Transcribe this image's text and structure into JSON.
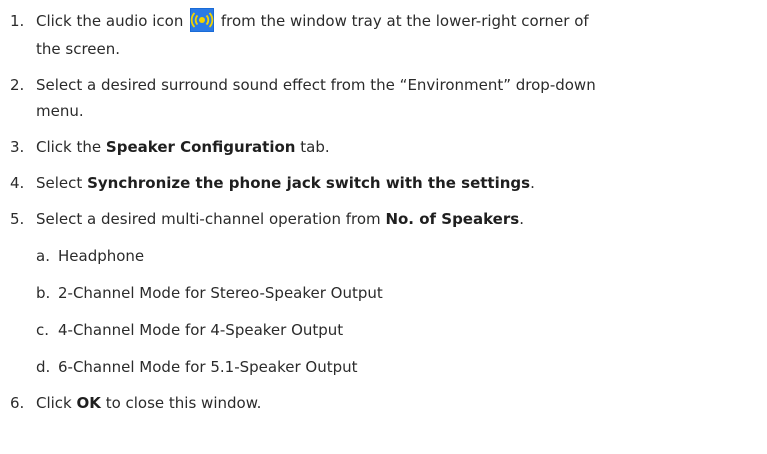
{
  "steps": [
    {
      "num": "1.",
      "pre": "Click the audio icon",
      "post": "from the window tray at the lower-right corner of",
      "cont": "the screen.",
      "icon": "audio-speaker-icon"
    },
    {
      "num": "2.",
      "line1": "Select a desired surround sound effect from the “Environment” drop-down",
      "cont": "menu."
    },
    {
      "num": "3.",
      "pre": "Click the",
      "bold": "Speaker Configuration",
      "post": "tab."
    },
    {
      "num": "4.",
      "pre": "Select",
      "bold": "Synchronize the phone jack switch with the settings",
      "post": "."
    },
    {
      "num": "5.",
      "pre": "Select a desired multi-channel operation from",
      "bold": "No. of Speakers",
      "post": "."
    },
    {
      "num": "6.",
      "pre": "Click",
      "bold": "OK",
      "post": "to close this window."
    }
  ],
  "substeps": [
    {
      "num": "a.",
      "text": "Headphone"
    },
    {
      "num": "b.",
      "text": "2-Channel Mode for Stereo-Speaker Output"
    },
    {
      "num": "c.",
      "text": "4-Channel Mode for 4-Speaker Output"
    },
    {
      "num": "d.",
      "text": "6-Channel Mode for 5.1-Speaker Output"
    }
  ],
  "colors": {
    "icon_bg": "#1a6bd6",
    "icon_fg": "#f2d400",
    "text": "#2b2b2b"
  }
}
